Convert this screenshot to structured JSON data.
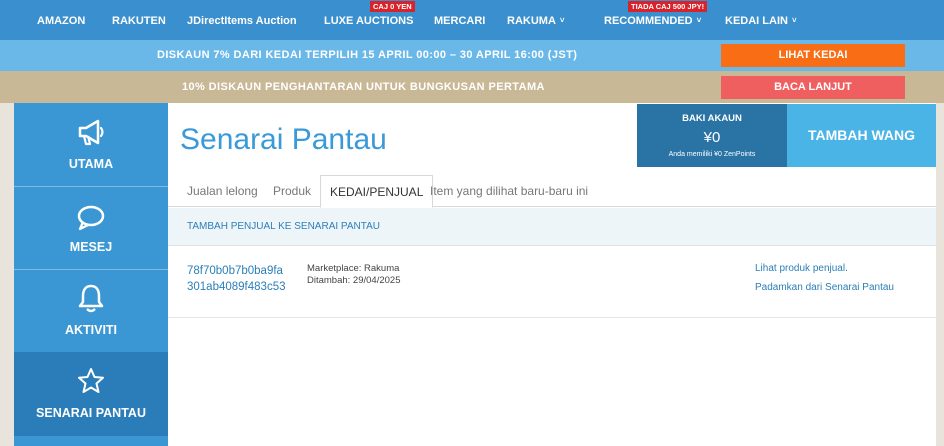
{
  "nav": {
    "items": [
      {
        "label": "AMAZON"
      },
      {
        "label": "RAKUTEN"
      },
      {
        "label": "JDirectItems Auction"
      },
      {
        "label": "LUXE AUCTIONS",
        "badge": "CAJ 0 YEN"
      },
      {
        "label": "MERCARI"
      },
      {
        "label": "RAKUMA",
        "dropdown": true
      },
      {
        "label": "RECOMMENDED",
        "badge": "TIADA CAJ 500 JPY!",
        "dropdown": true
      },
      {
        "label": "KEDAI LAIN",
        "dropdown": true
      }
    ],
    "chevron": "˅"
  },
  "banners": {
    "promo": {
      "text": "DISKAUN 7% DARI KEDAI TERPILIH 15 APRIL 00:00 – 30 APRIL 16:00 (JST)",
      "button": "LIHAT KEDAI"
    },
    "shipping": {
      "text": "10% DISKAUN PENGHANTARAN UNTUK BUNGKUSAN PERTAMA",
      "button": "BACA LANJUT"
    }
  },
  "sidebar": {
    "items": [
      {
        "label": "UTAMA",
        "icon": "megaphone-icon"
      },
      {
        "label": "MESEJ",
        "icon": "speech-bubble-icon"
      },
      {
        "label": "AKTIVITI",
        "icon": "bell-icon"
      },
      {
        "label": "SENARAI PANTAU",
        "icon": "star-icon",
        "active": true
      }
    ]
  },
  "main": {
    "title": "Senarai Pantau",
    "balance": {
      "title": "BAKI AKAUN",
      "amount": "¥0",
      "note": "Anda memiliki ¥0 ZenPoints"
    },
    "topup_label": "TAMBAH WANG",
    "tabs": [
      {
        "label": "Jualan lelong"
      },
      {
        "label": "Produk"
      },
      {
        "label": "KEDAI/PENJUAL",
        "active": true
      },
      {
        "label": "Item yang dilihat baru-baru ini"
      }
    ],
    "add_seller_label": "TAMBAH PENJUAL KE SENARAI PANTAU",
    "rows": [
      {
        "seller_id": "78f70b0b7b0ba9fa301ab4089f483c53",
        "marketplace": "Marketplace: Rakuma",
        "added": "Ditambah: 29/04/2025",
        "view_link": "Lihat produk penjual.",
        "remove_link": "Padamkan dari Senarai Pantau"
      }
    ]
  },
  "colors": {
    "nav": "#3a8fce",
    "promo_banner": "#6ab8e8",
    "shipping_banner": "#c9b896",
    "promo_button": "#f96d14",
    "shipping_button": "#f05f5f",
    "sidebar": "#3a97d3",
    "sidebar_active": "#2a7db8",
    "balance": "#2a73a5",
    "topup": "#4ab4e6",
    "link": "#2b7fb8",
    "badge": "#d9232b"
  }
}
